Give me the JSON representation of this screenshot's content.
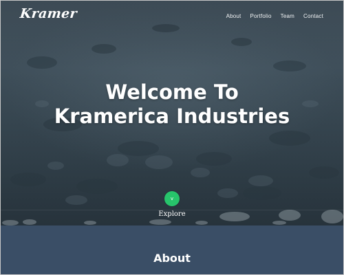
{
  "brand": {
    "logo_text": "Kramer"
  },
  "nav": {
    "items": [
      {
        "label": "About"
      },
      {
        "label": "Portfolio"
      },
      {
        "label": "Team"
      },
      {
        "label": "Contact"
      }
    ]
  },
  "hero": {
    "headline_line1": "Welcome To",
    "headline_line2": "Kramerica Industries",
    "explore_button_glyph": "v",
    "explore_label": "Explore",
    "background_description_icon": "water-rocks-photo"
  },
  "about": {
    "title": "About"
  },
  "colors": {
    "explore_button": "#27c46b",
    "about_background": "#3a4e66",
    "hero_overlay": "#3d4d58",
    "text": "#ffffff"
  }
}
